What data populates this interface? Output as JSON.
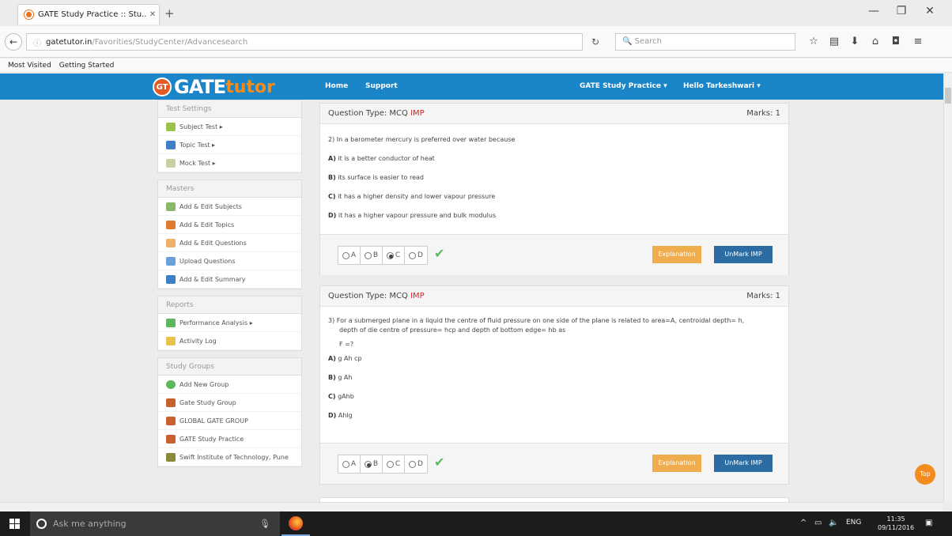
{
  "browser": {
    "tab_title": "GATE Study Practice :: Stu...",
    "url_domain": "gatetutor.in",
    "url_path": "/Favorities/StudyCenter/Advancesearch",
    "search_placeholder": "Search",
    "bookmarks": [
      "Most Visited",
      "Getting Started"
    ]
  },
  "header": {
    "logo_badge": "GT",
    "logo_main": "GATE",
    "logo_accent": "tutor",
    "nav": [
      "Home",
      "Support"
    ],
    "right_nav": [
      "GATE Study Practice ▾",
      "Hello Tarkeshwari ▾"
    ]
  },
  "sidebar": {
    "test_settings": {
      "title": "Test Settings",
      "items": [
        "Subject Test ▸",
        "Topic Test ▸",
        "Mock Test ▸"
      ]
    },
    "masters": {
      "title": "Masters",
      "items": [
        "Add & Edit Subjects",
        "Add & Edit Topics",
        "Add & Edit Questions",
        "Upload Questions",
        "Add & Edit Summary"
      ]
    },
    "reports": {
      "title": "Reports",
      "items": [
        "Performance Analysis ▸",
        "Activity Log"
      ]
    },
    "study_groups": {
      "title": "Study Groups",
      "items": [
        "Add New Group",
        "Gate Study Group",
        "GLOBAL GATE GROUP",
        "GATE Study Practice",
        "Swift Institute of Technology, Pune"
      ]
    }
  },
  "questions": [
    {
      "type_label": "Question Type: MCQ",
      "imp": "IMP",
      "marks": "Marks: 1",
      "text": "2) In a barometer mercury is preferred over water because",
      "options": [
        {
          "key": "A)",
          "text": "it is a better conductor of heat"
        },
        {
          "key": "B)",
          "text": "its surface is easier to read"
        },
        {
          "key": "C)",
          "text": "it has a higher density and lower vapour pressure"
        },
        {
          "key": "D)",
          "text": "it has a higher vapour pressure and bulk modulus"
        }
      ],
      "answer_choices": [
        "A",
        "B",
        "C",
        "D"
      ],
      "selected": "C",
      "explanation_label": "Explanation",
      "unmark_label": "UnMark IMP"
    },
    {
      "type_label": "Question Type: MCQ",
      "imp": "IMP",
      "marks": "Marks: 1",
      "text": "3) For a submerged plane in a liquid the centre of fluid pressure on one side of the plane is related to area=A, centroidal depth= h,",
      "text2": "depth of die centre of pressure= hcp and depth of bottom edge= hb as",
      "text3": "F =?",
      "options": [
        {
          "key": "A)",
          "text": "g Ah cp"
        },
        {
          "key": "B)",
          "text": "g Ah"
        },
        {
          "key": "C)",
          "text": "gAhb"
        },
        {
          "key": "D)",
          "text": "Ahlg"
        }
      ],
      "answer_choices": [
        "A",
        "B",
        "C",
        "D"
      ],
      "selected": "B",
      "explanation_label": "Explanation",
      "unmark_label": "UnMark IMP"
    }
  ],
  "top_button": "Top",
  "taskbar": {
    "search_placeholder": "Ask me anything",
    "lang": "ENG",
    "time": "11:35",
    "date": "09/11/2016"
  }
}
